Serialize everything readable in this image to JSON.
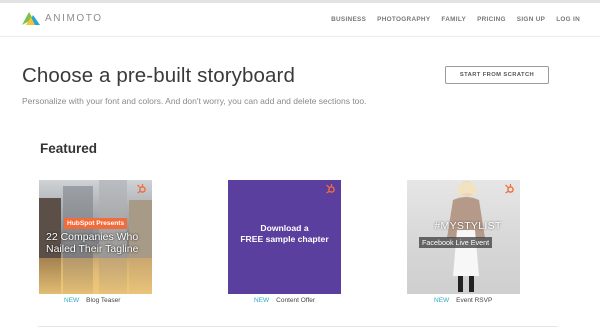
{
  "header": {
    "logo_text": "ANIMOTO",
    "nav": [
      "BUSINESS",
      "PHOTOGRAPHY",
      "FAMILY",
      "PRICING",
      "SIGN UP",
      "LOG IN"
    ]
  },
  "main": {
    "title": "Choose a pre-built storyboard",
    "subtitle": "Personalize with your font and colors. And don't worry, you can add and delete sections too.",
    "scratch_button": "START FROM SCRATCH",
    "section_title": "Featured"
  },
  "cards": [
    {
      "badge": "NEW",
      "name": "Blog Teaser",
      "tag": "HubSpot Presents",
      "headline": "22 Companies Who Nailed Their Tagline"
    },
    {
      "badge": "NEW",
      "name": "Content Offer",
      "headline_line1": "Download a",
      "headline_line2": "FREE sample chapter"
    },
    {
      "badge": "NEW",
      "name": "Event RSVP",
      "headline": "#MYSTYLIST",
      "subline": "Facebook Live Event"
    }
  ],
  "colors": {
    "accent_new": "#2fa8c8",
    "hubspot_orange": "#f26b3a",
    "purple_card": "#5b3f9e"
  }
}
